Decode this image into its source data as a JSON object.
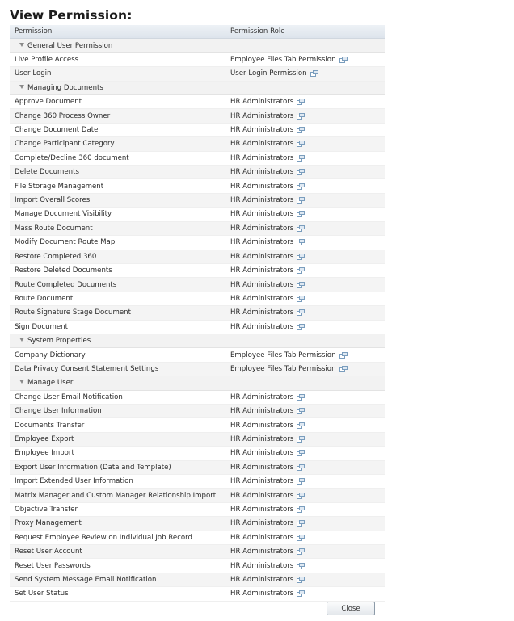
{
  "title": "View Permission:",
  "table": {
    "columns": [
      "Permission",
      "Permission Role"
    ],
    "groups": [
      {
        "label": "General User Permission",
        "rows": [
          {
            "permission": "Live Profile Access",
            "role": "Employee Files Tab Permission"
          },
          {
            "permission": "User Login",
            "role": "User Login Permission"
          }
        ]
      },
      {
        "label": "Managing Documents",
        "rows": [
          {
            "permission": "Approve Document",
            "role": "HR Administrators"
          },
          {
            "permission": "Change 360 Process Owner",
            "role": "HR Administrators"
          },
          {
            "permission": "Change Document Date",
            "role": "HR Administrators"
          },
          {
            "permission": "Change Participant Category",
            "role": "HR Administrators"
          },
          {
            "permission": "Complete/Decline 360 document",
            "role": "HR Administrators"
          },
          {
            "permission": "Delete Documents",
            "role": "HR Administrators"
          },
          {
            "permission": "File Storage Management",
            "role": "HR Administrators"
          },
          {
            "permission": "Import Overall Scores",
            "role": "HR Administrators"
          },
          {
            "permission": "Manage Document Visibility",
            "role": "HR Administrators"
          },
          {
            "permission": "Mass Route Document",
            "role": "HR Administrators"
          },
          {
            "permission": "Modify Document Route Map",
            "role": "HR Administrators"
          },
          {
            "permission": "Restore Completed 360",
            "role": "HR Administrators"
          },
          {
            "permission": "Restore Deleted Documents",
            "role": "HR Administrators"
          },
          {
            "permission": "Route Completed Documents",
            "role": "HR Administrators"
          },
          {
            "permission": "Route Document",
            "role": "HR Administrators"
          },
          {
            "permission": "Route Signature Stage Document",
            "role": "HR Administrators"
          },
          {
            "permission": "Sign Document",
            "role": "HR Administrators"
          }
        ]
      },
      {
        "label": "System Properties",
        "rows": [
          {
            "permission": "Company Dictionary",
            "role": "Employee Files Tab Permission"
          },
          {
            "permission": "Data Privacy Consent Statement Settings",
            "role": "Employee Files Tab Permission"
          }
        ]
      },
      {
        "label": "Manage User",
        "rows": [
          {
            "permission": "Change User Email Notification",
            "role": "HR Administrators"
          },
          {
            "permission": "Change User Information",
            "role": "HR Administrators"
          },
          {
            "permission": "Documents Transfer",
            "role": "HR Administrators"
          },
          {
            "permission": "Employee Export",
            "role": "HR Administrators"
          },
          {
            "permission": "Employee Import",
            "role": "HR Administrators"
          },
          {
            "permission": "Export User Information (Data and Template)",
            "role": "HR Administrators"
          },
          {
            "permission": "Import Extended User Information",
            "role": "HR Administrators"
          },
          {
            "permission": "Matrix Manager and Custom Manager Relationship Import",
            "role": "HR Administrators"
          },
          {
            "permission": "Objective Transfer",
            "role": "HR Administrators"
          },
          {
            "permission": "Proxy Management",
            "role": "HR Administrators"
          },
          {
            "permission": "Request Employee Review on Individual Job Record",
            "role": "HR Administrators"
          },
          {
            "permission": "Reset User Account",
            "role": "HR Administrators"
          },
          {
            "permission": "Reset User Passwords",
            "role": "HR Administrators"
          },
          {
            "permission": "Send System Message Email Notification",
            "role": "HR Administrators"
          },
          {
            "permission": "Set User Status",
            "role": "HR Administrators"
          }
        ]
      }
    ]
  },
  "icons": {
    "group_toggle": "triangle-down-icon",
    "role_link": "open-in-popup-icon"
  },
  "close_button": "Close"
}
